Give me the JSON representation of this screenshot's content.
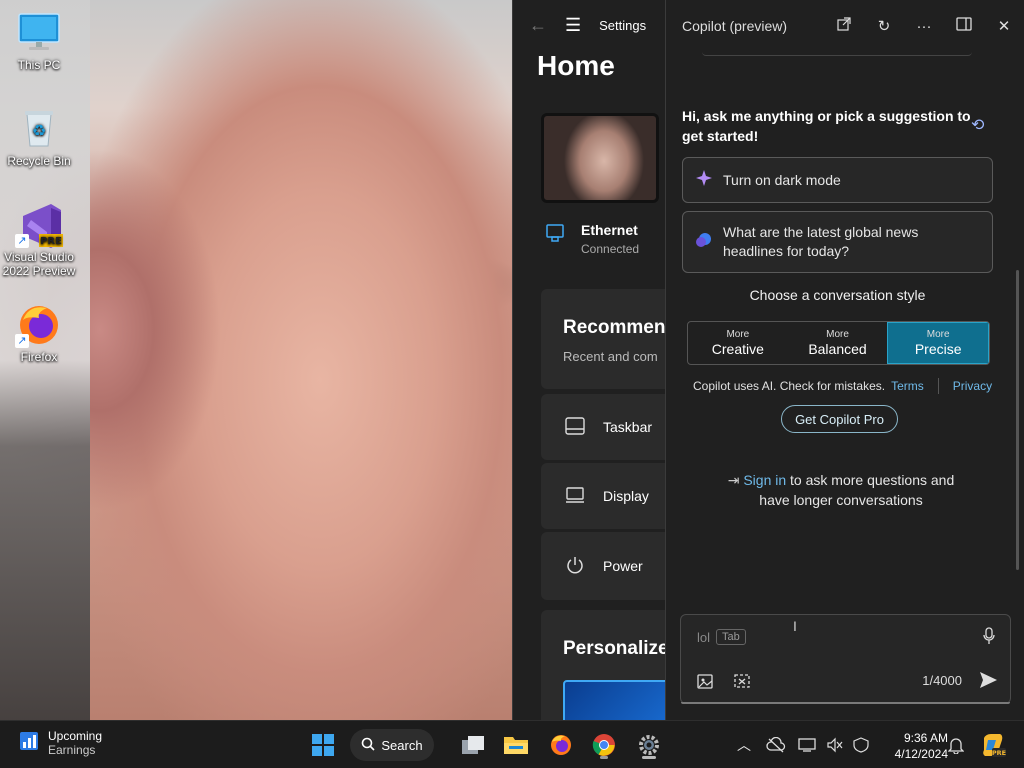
{
  "desktop": {
    "icons": [
      {
        "label": "This PC"
      },
      {
        "label": "Recycle Bin"
      },
      {
        "label": "Visual Studio 2022 Preview",
        "badge": "PRE"
      },
      {
        "label": "Firefox"
      }
    ]
  },
  "settings": {
    "title": "Settings",
    "page_title": "Home",
    "network": {
      "title": "Ethernet",
      "status": "Connected"
    },
    "recommended": {
      "title": "Recommen",
      "subtitle": "Recent and com"
    },
    "items": [
      {
        "label": "Taskbar",
        "icon": "taskbar-icon"
      },
      {
        "label": "Display",
        "icon": "display-icon"
      },
      {
        "label": "Power",
        "icon": "power-icon"
      }
    ],
    "personalize": {
      "title": "Personalize"
    }
  },
  "copilot": {
    "title": "Copilot (preview)",
    "prompt": "Hi, ask me anything or pick a suggestion to get started!",
    "suggestions": [
      {
        "label": "Turn on dark mode",
        "icon": "sparkle-icon"
      },
      {
        "label": "What are the latest global news headlines for today?",
        "icon": "chat-bubble-icon"
      }
    ],
    "style_label": "Choose a conversation style",
    "styles": [
      {
        "small": "More",
        "big": "Creative",
        "active": false
      },
      {
        "small": "More",
        "big": "Balanced",
        "active": false
      },
      {
        "small": "More",
        "big": "Precise",
        "active": true
      }
    ],
    "disclaimer": "Copilot uses AI. Check for mistakes.",
    "terms": "Terms",
    "privacy": "Privacy",
    "pro_button": "Get Copilot Pro",
    "signin_link": "Sign in",
    "signin_text": " to ask more questions and have longer conversations",
    "input_value": "lol",
    "tab_hint": "Tab",
    "char_count": "1/4000"
  },
  "taskbar": {
    "widget_title": "Upcoming",
    "widget_subtitle": "Earnings",
    "search_label": "Search",
    "time": "9:36 AM",
    "date": "4/12/2024"
  },
  "colors": {
    "accent": "#0f6f8f",
    "link": "#6fb9e8",
    "panel_bg": "#202020"
  }
}
